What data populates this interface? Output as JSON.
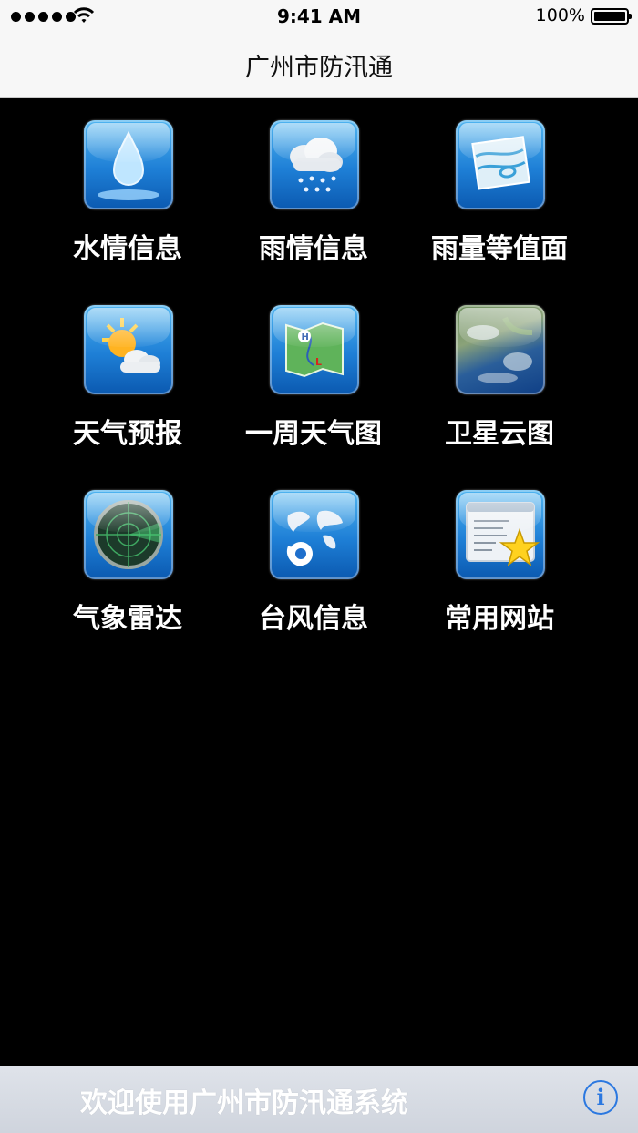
{
  "status_bar": {
    "time": "9:41 AM",
    "battery": "100%",
    "signal_icon": "signal-dots-icon",
    "wifi_icon": "wifi-icon",
    "battery_icon": "battery-icon"
  },
  "nav": {
    "title": "广州市防汛通"
  },
  "menu": [
    {
      "label": "水情信息",
      "icon": "water-drop-icon"
    },
    {
      "label": "雨情信息",
      "icon": "rain-cloud-icon"
    },
    {
      "label": "雨量等值面",
      "icon": "contour-map-icon"
    },
    {
      "label": "天气预报",
      "icon": "sun-cloud-icon"
    },
    {
      "label": "一周天气图",
      "icon": "weather-map-icon"
    },
    {
      "label": "卫星云图",
      "icon": "satellite-image-icon"
    },
    {
      "label": "气象雷达",
      "icon": "radar-icon"
    },
    {
      "label": "台风信息",
      "icon": "typhoon-globe-icon"
    },
    {
      "label": "常用网站",
      "icon": "favorite-website-icon"
    }
  ],
  "bottom_bar": {
    "welcome": "欢迎使用广州市防汛通系统",
    "info_glyph": "i",
    "info_icon": "info-icon"
  },
  "colors": {
    "background": "#000000",
    "nav_bg": "#f7f7f7",
    "accent": "#2b78e0",
    "icon_blue": "#1e7fd6"
  }
}
